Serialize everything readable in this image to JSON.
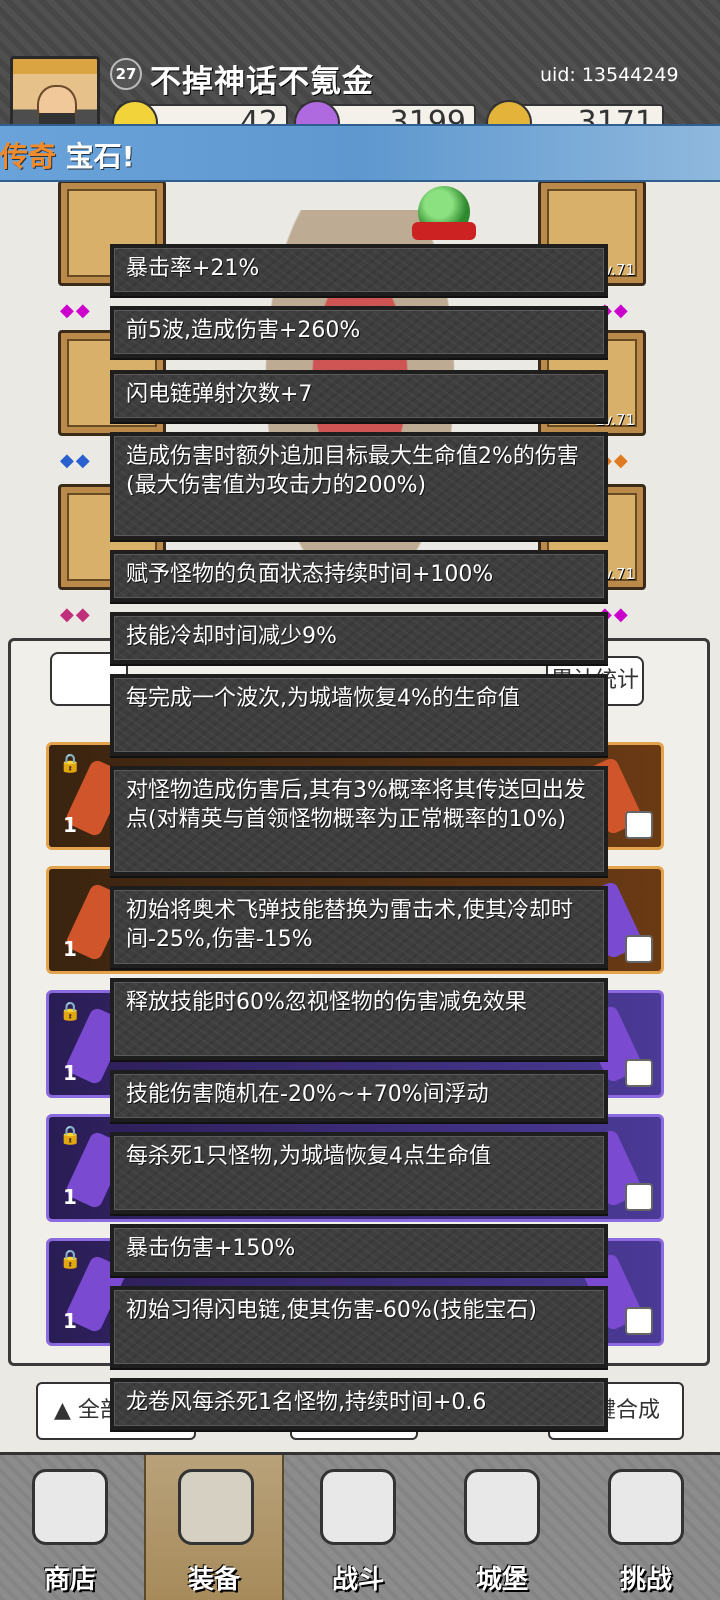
{
  "player": {
    "level": "27",
    "name": "不掉神话不氪金",
    "uid": "uid: 13544249"
  },
  "currencies": [
    {
      "name": "gold-bar",
      "value": "42",
      "color": "#f2d43a"
    },
    {
      "name": "gem",
      "value": "3199",
      "color": "#b06ae0"
    },
    {
      "name": "coin",
      "value": "3171",
      "color": "#e3b33a"
    }
  ],
  "banner": {
    "prefix": "传奇",
    "text": " 宝石!"
  },
  "equip_slots": [
    {
      "level": "Lv.71"
    },
    {
      "level": "Lv.71"
    },
    {
      "level": "Lv.71"
    }
  ],
  "inventory": {
    "stats_button": "累计统计",
    "rows": [
      {
        "count": "1",
        "tier": "orange"
      },
      {
        "count": "1",
        "tier": "orange"
      },
      {
        "count": "1",
        "tier": "purple"
      },
      {
        "count": "1",
        "tier": "purple"
      },
      {
        "count": "1",
        "tier": "purple"
      }
    ]
  },
  "bottom_buttons": {
    "filter": "全部",
    "merge": "一键合成"
  },
  "tooltips": [
    "暴击率+21%",
    "前5波,造成伤害+260%",
    "闪电链弹射次数+7",
    "造成伤害时额外追加目标最大生命值2%的伤害(最大伤害值为攻击力的200%)",
    "赋予怪物的负面状态持续时间+100%",
    "技能冷却时间减少9%",
    "每完成一个波次,为城墙恢复4%的生命值",
    "对怪物造成伤害后,其有3%概率将其传送回出发点(对精英与首领怪物概率为正常概率的10%)",
    "初始将奥术飞弹技能替换为雷击术,使其冷却时间-25%,伤害-15%",
    "释放技能时60%忽视怪物的伤害减免效果",
    "技能伤害随机在-20%~+70%间浮动",
    "每杀死1只怪物,为城墙恢复4点生命值",
    "暴击伤害+150%",
    "初始习得闪电链,使其伤害-60%(技能宝石)",
    "龙卷风每杀死1名怪物,持续时间+0.6"
  ],
  "nav": [
    {
      "label": "商店",
      "icon": "shop-icon"
    },
    {
      "label": "装备",
      "icon": "equipment-bag-icon",
      "active": true
    },
    {
      "label": "战斗",
      "icon": "crossed-swords-icon"
    },
    {
      "label": "城堡",
      "icon": "castle-icon"
    },
    {
      "label": "挑战",
      "icon": "challenge-shield-icon"
    }
  ]
}
